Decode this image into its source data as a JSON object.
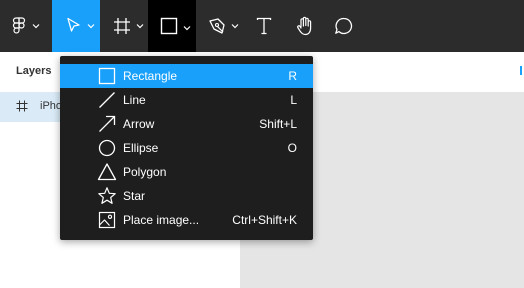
{
  "toolbar": {
    "tools": [
      {
        "name": "main-menu",
        "icon": "figma-logo-icon",
        "has_chevron": true
      },
      {
        "name": "move",
        "icon": "cursor-icon",
        "has_chevron": true,
        "active": true
      },
      {
        "name": "frame",
        "icon": "frame-icon",
        "has_chevron": true
      },
      {
        "name": "shape",
        "icon": "rectangle-icon",
        "has_chevron": true,
        "open": true
      },
      {
        "name": "pen",
        "icon": "pen-icon",
        "has_chevron": true
      },
      {
        "name": "text",
        "icon": "text-icon",
        "has_chevron": false
      },
      {
        "name": "hand",
        "icon": "hand-icon",
        "has_chevron": false
      },
      {
        "name": "comment",
        "icon": "comment-icon",
        "has_chevron": false
      }
    ]
  },
  "layers": {
    "header": "Layers",
    "items": [
      {
        "icon": "frame-icon",
        "label": "iPho"
      }
    ]
  },
  "shape_menu": {
    "items": [
      {
        "icon": "rectangle-icon",
        "label": "Rectangle",
        "shortcut": "R",
        "highlighted": true
      },
      {
        "icon": "line-icon",
        "label": "Line",
        "shortcut": "L"
      },
      {
        "icon": "arrow-icon",
        "label": "Arrow",
        "shortcut": "Shift+L"
      },
      {
        "icon": "ellipse-icon",
        "label": "Ellipse",
        "shortcut": "O"
      },
      {
        "icon": "polygon-icon",
        "label": "Polygon",
        "shortcut": ""
      },
      {
        "icon": "star-icon",
        "label": "Star",
        "shortcut": ""
      },
      {
        "icon": "image-icon",
        "label": "Place image...",
        "shortcut": "Ctrl+Shift+K"
      }
    ]
  },
  "colors": {
    "toolbar_bg": "#2c2c2c",
    "accent": "#18a0fb",
    "menu_bg": "#1e1e1e",
    "layer_selected": "#daebf7",
    "canvas_bg": "#e5e5e5"
  }
}
